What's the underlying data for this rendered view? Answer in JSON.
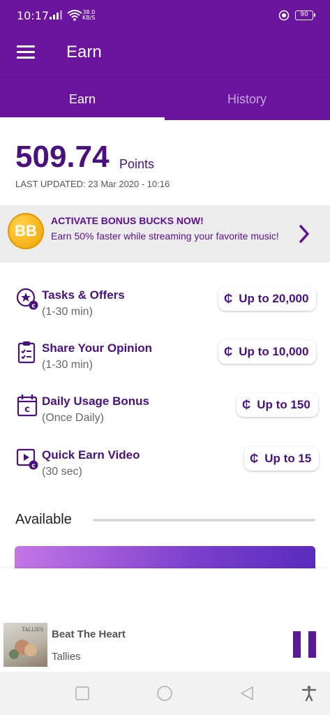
{
  "status_bar": {
    "time": "10:17",
    "speed_value": "38.0",
    "speed_unit": "KB/S",
    "battery": "90",
    "icons": [
      "signal-icon",
      "wifi-icon",
      "power-save-icon",
      "battery-icon"
    ]
  },
  "app_bar": {
    "title": "Earn",
    "menu_icon": "hamburger-menu-icon"
  },
  "tabs": [
    {
      "label": "Earn",
      "selected": true
    },
    {
      "label": "History",
      "selected": false
    }
  ],
  "points": {
    "value": "509.74",
    "unit": "Points",
    "last_updated": "LAST UPDATED: 23 Mar 2020 - 10:16"
  },
  "bonus_banner": {
    "badge": "BB",
    "title": "ACTIVATE BONUS BUCKS NOW!",
    "text": "Earn 50% faster while streaming your favorite music!",
    "icon": "chevron-right-icon"
  },
  "offers": [
    {
      "title": "Tasks & Offers",
      "subtitle": "(1-30 min)",
      "reward": "Up to 20,000",
      "icon": "star-coin-icon"
    },
    {
      "title": "Share Your Opinion",
      "subtitle": "(1-30 min)",
      "reward": "Up to 10,000",
      "icon": "clipboard-check-icon"
    },
    {
      "title": "Daily Usage Bonus",
      "subtitle": "(Once Daily)",
      "reward": "Up to 150",
      "icon": "calendar-coin-icon"
    },
    {
      "title": "Quick Earn Video",
      "subtitle": "(30 sec)",
      "reward": "Up to 15",
      "icon": "video-coin-icon"
    }
  ],
  "currency_glyph": "₵",
  "available": {
    "label": "Available"
  },
  "player": {
    "album_text": "TALLIES",
    "track": "Beat The Heart",
    "artist": "Tallies",
    "control_icon": "pause-icon"
  },
  "nav_bar": {
    "icons": [
      "square-icon",
      "circle-icon",
      "back-triangle-icon",
      "accessibility-icon"
    ]
  },
  "colors": {
    "primary": "#6a14a0",
    "accent_text": "#4a1080",
    "badge": "#f0a000"
  }
}
